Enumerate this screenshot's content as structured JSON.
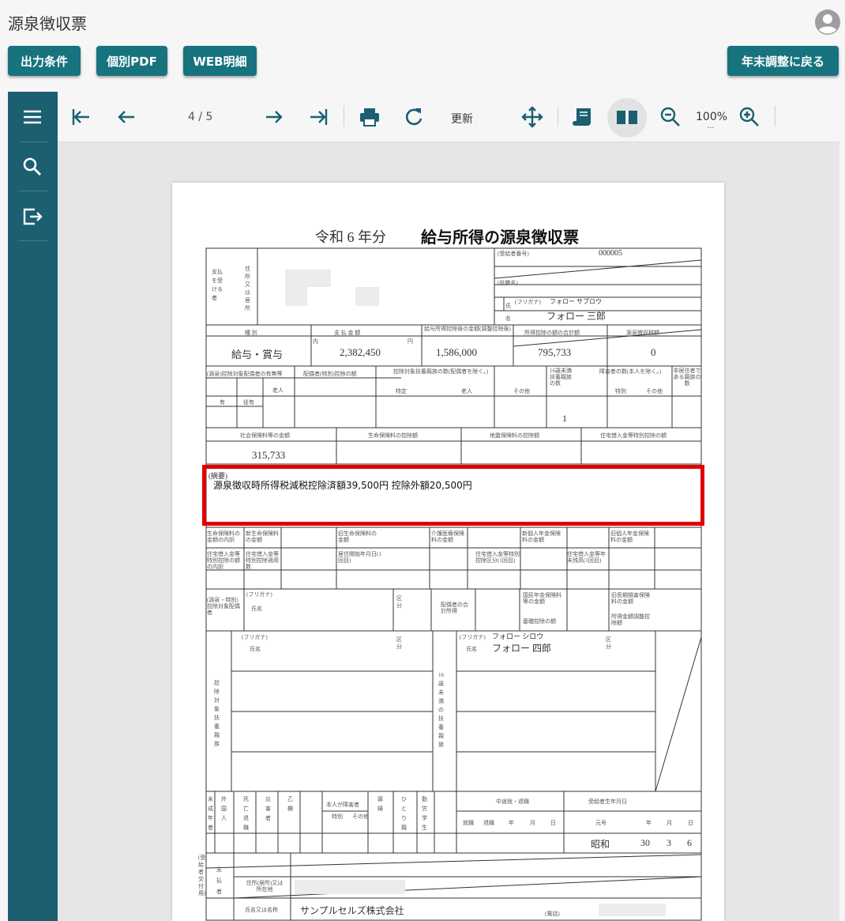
{
  "app": {
    "title": "源泉徴収票"
  },
  "toolbar": {
    "output_conditions": "出力条件",
    "individual_pdf": "個別PDF",
    "web_detail": "WEB明細",
    "back_to_year_end": "年末調整に戻る"
  },
  "viewer": {
    "page_indicator": "4 / 5",
    "refresh_label": "更新",
    "zoom_level": "100%",
    "zoom_dots": "..."
  },
  "doc": {
    "era_year": "令和 6 年分",
    "title": "給与所得の源泉徴収票",
    "recipient_no_label": "(受給者番号)",
    "recipient_no": "000005",
    "position_label": "(役職名)",
    "payee_label": "支払を受ける者",
    "address_label": "住所又は居所",
    "name_label": "氏名",
    "furigana_label": "(フリガナ)",
    "name_kana": "フォロー サブロウ",
    "name": "フォロー 三郎",
    "col_kind": "種 別",
    "col_pay": "支 払 金 額",
    "col_after_deduction": "給与所得控除後の金額(調整控除後)",
    "col_total_deductions": "所得控除の額の合計額",
    "col_withholding": "源泉徴収税額",
    "kind": "給与・賞与",
    "pay": "2,382,450",
    "after_deduction": "1,586,000",
    "total_deductions": "795,733",
    "withholding": "0",
    "yen": "円",
    "inside": "内",
    "spouse_label": "(源泉)控除対象配偶者の有無等",
    "spouse_special_label": "配偶者(特別)控除の額",
    "dependents_label": "控除対象扶養親族の数(配偶者を除く。)",
    "under16_label": "16歳未満扶養親族の数",
    "disabled_label": "障害者の数(本人を除く。)",
    "nonresident_label": "非居住者である親族の数",
    "old_label": "老人",
    "specific_label": "特定",
    "other_label": "その他",
    "special_label": "特別",
    "yes_label": "有",
    "exempt_label": "従有",
    "person_label": "人",
    "under16_count": "1",
    "social_ins_label": "社会保険料等の金額",
    "life_ins_label": "生命保険料の控除額",
    "quake_ins_label": "地震保険料の控除額",
    "housing_label": "住宅借入金等特別控除の額",
    "social_ins": "315,733",
    "remarks_label": "(摘要)",
    "remarks": "源泉徴収時所得税減税控除済額39,500円 控除外額20,500円",
    "dep_name": "フォロー 四郎",
    "dep_kana": "フォロー シロウ",
    "dep16_label": "16歳未満の扶養親族",
    "dep_label": "控除対象扶養親族",
    "kubun": "区分",
    "name_short": "氏名",
    "bottom_heads": [
      "未成年者",
      "外国人",
      "死亡退職",
      "災害者",
      "乙欄",
      "本人が障害者",
      "寡婦",
      "ひとり親",
      "勤労学生"
    ],
    "bottom_sub": [
      "特別",
      "その他"
    ],
    "midyear_label": "中途就・退職",
    "birth_label": "受給者生年月日",
    "midyear_cols": [
      "就職",
      "退職",
      "年",
      "月",
      "日"
    ],
    "birth_cols": [
      "元号",
      "年",
      "月",
      "日"
    ],
    "birth_era": "昭和",
    "birth_year": "30",
    "birth_month": "3",
    "birth_day": "6",
    "payer_label": "支払者",
    "recipient_copy": "(受給者交付用)",
    "payer_addr_label": "住所(居所)又は所在地",
    "payer_name_label": "氏名又は名称",
    "payer_name": "サンプルセルズ株式会社",
    "phone_label": "(電話)",
    "ins_row1": [
      "生命保険料の金額の内訳",
      "新生命保険料の金額",
      "旧生命保険料の金額",
      "介護医療保険料の金額",
      "新個人年金保険料の金額",
      "旧個人年金保険料の金額"
    ],
    "loan_row": [
      "住宅借入金等特別控除の額の内訳",
      "住宅借入金等特別控除適用数",
      "居住開始年月日(1回目)",
      "住宅借入金等特別控除区分(1回目)",
      "住宅借入金等年末残高(1回目)"
    ],
    "spouse_detail": [
      "(源泉・特別)控除対象配偶者",
      "配偶者の合計所得",
      "国民年金保険料等の金額",
      "旧長期損害保険料の金額",
      "基礎控除の額",
      "所得金額調整控除額"
    ]
  }
}
